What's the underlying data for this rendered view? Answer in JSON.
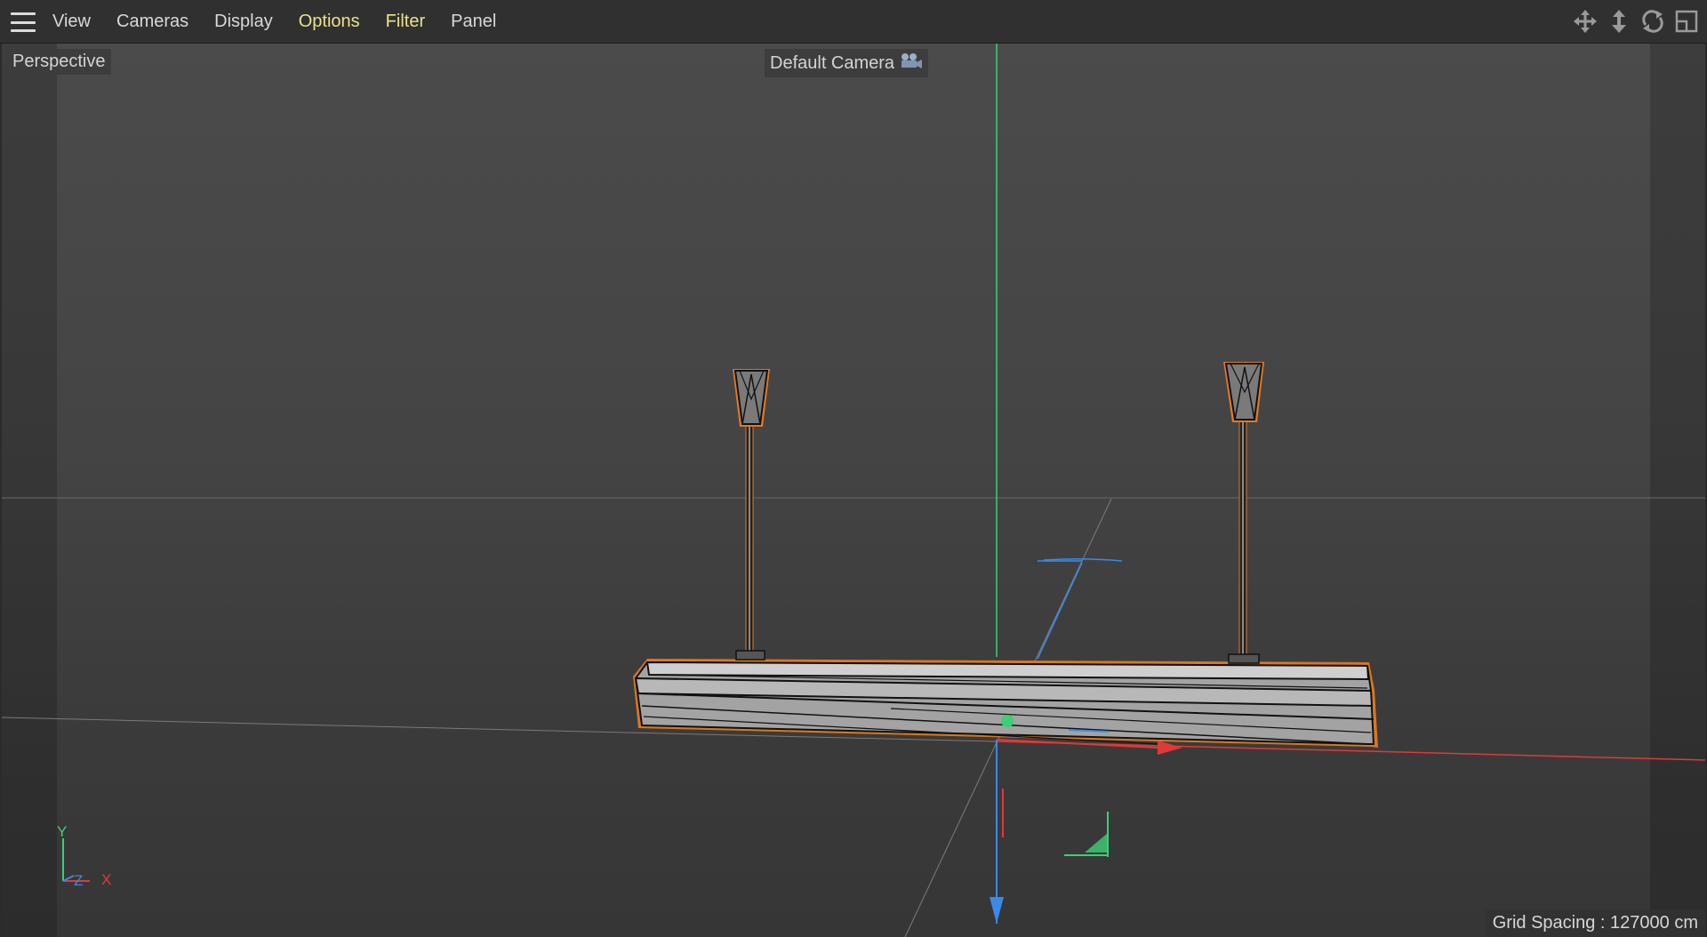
{
  "menubar": {
    "items": [
      {
        "label": "View"
      },
      {
        "label": "Cameras"
      },
      {
        "label": "Display"
      },
      {
        "label": "Options"
      },
      {
        "label": "Filter"
      },
      {
        "label": "Panel"
      }
    ],
    "nav_icons": [
      "move-view-icon",
      "zoom-view-icon",
      "rotate-view-icon",
      "toggle-layout-icon"
    ]
  },
  "viewport": {
    "projection_label": "Perspective",
    "camera_label": "Default Camera",
    "grid_spacing": "Grid Spacing : 127000 cm",
    "axis": {
      "y": "Y",
      "z": "Z",
      "x": "X"
    }
  },
  "colors": {
    "menu_highlight": "#e8e38a",
    "axis_x": "#e0393a",
    "axis_y": "#3ccf78",
    "axis_z": "#3a8ae8",
    "selection_outline": "#e07a20"
  }
}
